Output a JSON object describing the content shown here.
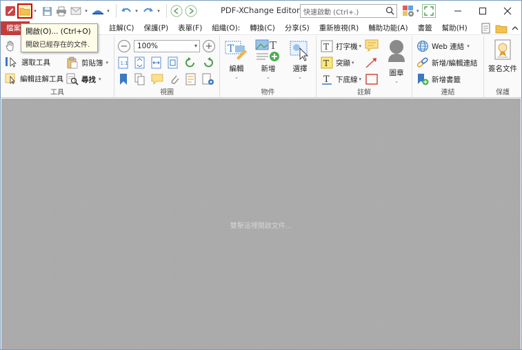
{
  "app": {
    "title": "PDF-XChange Editor"
  },
  "quick_search": {
    "placeholder": "快速啟動 (Ctrl+.)"
  },
  "tooltip": {
    "title": "開啟(O)... (Ctrl+O)",
    "description": "開啟已經存在的文件."
  },
  "menu": {
    "file": "檔案",
    "items": [
      "註解(C)",
      "保護(P)",
      "表單(F)",
      "組織(O):",
      "轉換(C)",
      "分享(S)",
      "重新檢視(R)",
      "輔助功能(A)",
      "書籤",
      "幫助(H)"
    ]
  },
  "ribbon": {
    "tools": {
      "label": "工具",
      "select_tool": "選取工具",
      "clipboard": "剪貼簿",
      "edit_annot_tool": "編輯註解工具",
      "find": "尋找"
    },
    "view": {
      "label": "視圖",
      "zoom": "100%"
    },
    "objects": {
      "label": "物件",
      "edit": "編輯",
      "add": "新增",
      "select": "選擇"
    },
    "comment": {
      "label": "註解",
      "typewriter": "打字機",
      "highlight": "突顯",
      "underline": "下底線",
      "stamp": "圖章"
    },
    "links": {
      "label": "連結",
      "web_links": "Web 連結",
      "add_edit_links": "新增/編輯連結",
      "add_bookmark": "新增書籤"
    },
    "protect": {
      "label": "保護",
      "sign_document": "簽名文件"
    }
  },
  "document": {
    "hint": "雙擊這裡開啟文件..."
  },
  "colors": {
    "file_tab": "#c33b3b",
    "doc_bg": "#a9a9a9",
    "highlight_border": "#d40000"
  }
}
